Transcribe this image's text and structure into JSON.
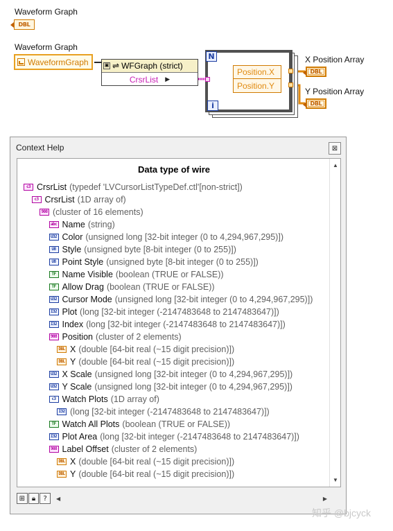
{
  "diagram": {
    "graph_terminal_label": "Waveform Graph",
    "graph_terminal_type": "DBL",
    "ref_label": "Waveform Graph",
    "ref_terminal_text": "WaveformGraph",
    "property_node_class": "WFGraph (strict)",
    "property_node_property": "CrsrList",
    "loop_count_terminal": "N",
    "loop_index_terminal": "i",
    "unbundle_fields": [
      "Position.X",
      "Position.Y"
    ],
    "x_output_label": "X Position Array",
    "y_output_label": "Y Position Array",
    "output_type": "DBL"
  },
  "context_help": {
    "title": "Context Help",
    "close_icon": "close-icon",
    "heading": "Data type of wire",
    "rows": [
      {
        "indent": 0,
        "icon": "clu",
        "icon_text": "c3",
        "name": "CrsrList",
        "desc": "(typedef 'LVCursorListTypeDef.ctl'[non-strict])"
      },
      {
        "indent": 1,
        "icon": "arr",
        "icon_text": "c3",
        "name": "CrsrList",
        "desc": "(1D array of)"
      },
      {
        "indent": 2,
        "icon": "clu",
        "icon_text": "908",
        "name": "",
        "desc": "(cluster of 16 elements)"
      },
      {
        "indent": 3,
        "icon": "str",
        "icon_text": "abc",
        "name": "Name",
        "desc": "(string)"
      },
      {
        "indent": 3,
        "icon": "u32",
        "icon_text": "U32",
        "name": "Color",
        "desc": "(unsigned long [32-bit integer (0 to 4,294,967,295)])"
      },
      {
        "indent": 3,
        "icon": "u8",
        "icon_text": "U8",
        "name": "Style",
        "desc": "(unsigned byte [8-bit integer (0 to 255)])"
      },
      {
        "indent": 3,
        "icon": "u8",
        "icon_text": "U8",
        "name": "Point Style",
        "desc": "(unsigned byte [8-bit integer (0 to 255)])"
      },
      {
        "indent": 3,
        "icon": "bool",
        "icon_text": "TF",
        "name": "Name Visible",
        "desc": "(boolean (TRUE or FALSE))"
      },
      {
        "indent": 3,
        "icon": "bool",
        "icon_text": "TF",
        "name": "Allow Drag",
        "desc": "(boolean (TRUE or FALSE))"
      },
      {
        "indent": 3,
        "icon": "u32",
        "icon_text": "U32",
        "name": "Cursor Mode",
        "desc": "(unsigned long [32-bit integer (0 to 4,294,967,295)])"
      },
      {
        "indent": 3,
        "icon": "i32",
        "icon_text": "I32",
        "name": "Plot",
        "desc": "(long [32-bit integer (-2147483648 to 2147483647)])"
      },
      {
        "indent": 3,
        "icon": "i32",
        "icon_text": "I32",
        "name": "Index",
        "desc": "(long [32-bit integer (-2147483648 to 2147483647)])"
      },
      {
        "indent": 3,
        "icon": "clu",
        "icon_text": "908",
        "name": "Position",
        "desc": "(cluster of 2 elements)"
      },
      {
        "indent": 4,
        "icon": "dbl",
        "icon_text": "DBL",
        "name": "X",
        "desc": "(double [64-bit real (~15 digit precision)])"
      },
      {
        "indent": 4,
        "icon": "dbl",
        "icon_text": "DBL",
        "name": "Y",
        "desc": "(double [64-bit real (~15 digit precision)])"
      },
      {
        "indent": 3,
        "icon": "u32",
        "icon_text": "U32",
        "name": "X Scale",
        "desc": "(unsigned long [32-bit integer (0 to 4,294,967,295)])"
      },
      {
        "indent": 3,
        "icon": "u32",
        "icon_text": "U32",
        "name": "Y Scale",
        "desc": "(unsigned long [32-bit integer (0 to 4,294,967,295)])"
      },
      {
        "indent": 3,
        "icon": "arr-b",
        "icon_text": "c3",
        "name": "Watch Plots",
        "desc": "(1D array of)"
      },
      {
        "indent": 4,
        "icon": "i32",
        "icon_text": "I32",
        "name": "",
        "desc": "(long [32-bit integer (-2147483648 to 2147483647)])"
      },
      {
        "indent": 3,
        "icon": "bool",
        "icon_text": "TF",
        "name": "Watch All Plots",
        "desc": "(boolean (TRUE or FALSE))"
      },
      {
        "indent": 3,
        "icon": "i32",
        "icon_text": "I32",
        "name": "Plot Area",
        "desc": "(long [32-bit integer (-2147483648 to 2147483647)])"
      },
      {
        "indent": 3,
        "icon": "clu",
        "icon_text": "908",
        "name": "Label Offset",
        "desc": "(cluster of 2 elements)"
      },
      {
        "indent": 4,
        "icon": "dbl",
        "icon_text": "DBL",
        "name": "X",
        "desc": "(double [64-bit real (~15 digit precision)])"
      },
      {
        "indent": 4,
        "icon": "dbl",
        "icon_text": "DBL",
        "name": "Y",
        "desc": "(double [64-bit real (~15 digit precision)])"
      }
    ],
    "toolbar": {
      "buttons": [
        "block-diagram-icon",
        "lock-icon",
        "help-icon"
      ],
      "help_glyph": "?"
    }
  },
  "watermark": "知乎 @bjcyck"
}
